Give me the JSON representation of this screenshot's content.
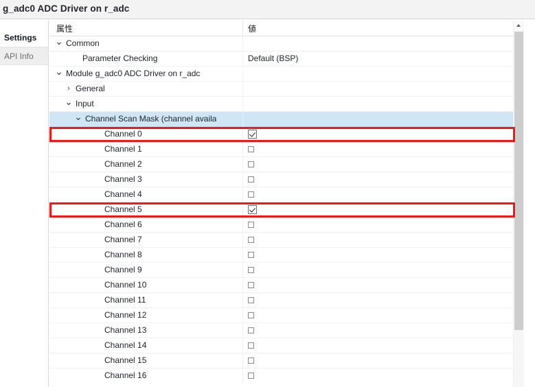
{
  "window": {
    "title": "g_adc0 ADC Driver on r_adc"
  },
  "tabs": [
    {
      "label": "Settings",
      "active": true
    },
    {
      "label": "API Info",
      "active": false
    }
  ],
  "table": {
    "columns": [
      {
        "key": "property",
        "label": "属性"
      },
      {
        "key": "value",
        "label": "値"
      }
    ]
  },
  "rows": [
    {
      "label": "Common",
      "indent": 0,
      "chevron": "v",
      "value": "",
      "control": "none"
    },
    {
      "label": "Parameter Checking",
      "indent": 1,
      "chevron": "",
      "value": "Default (BSP)",
      "control": "text"
    },
    {
      "label": "Module g_adc0 ADC Driver on r_adc",
      "indent": 0,
      "chevron": "v",
      "value": "",
      "control": "none"
    },
    {
      "label": "General",
      "indent": 1,
      "chevron": ">",
      "value": "",
      "control": "none"
    },
    {
      "label": "Input",
      "indent": 1,
      "chevron": "v",
      "value": "",
      "control": "none"
    },
    {
      "label": "Channel Scan Mask (channel availa",
      "indent": 2,
      "chevron": "v",
      "value": "",
      "control": "none",
      "selected": true,
      "truncated": true
    },
    {
      "label": "Channel 0",
      "indent": 3,
      "chevron": "",
      "value": "",
      "control": "checkbox",
      "checked": true,
      "highlighted": true
    },
    {
      "label": "Channel 1",
      "indent": 3,
      "chevron": "",
      "value": "",
      "control": "checkbox",
      "checked": false
    },
    {
      "label": "Channel 2",
      "indent": 3,
      "chevron": "",
      "value": "",
      "control": "checkbox",
      "checked": false
    },
    {
      "label": "Channel 3",
      "indent": 3,
      "chevron": "",
      "value": "",
      "control": "checkbox",
      "checked": false
    },
    {
      "label": "Channel 4",
      "indent": 3,
      "chevron": "",
      "value": "",
      "control": "checkbox",
      "checked": false
    },
    {
      "label": "Channel 5",
      "indent": 3,
      "chevron": "",
      "value": "",
      "control": "checkbox",
      "checked": true,
      "highlighted": true
    },
    {
      "label": "Channel 6",
      "indent": 3,
      "chevron": "",
      "value": "",
      "control": "checkbox",
      "checked": false
    },
    {
      "label": "Channel 7",
      "indent": 3,
      "chevron": "",
      "value": "",
      "control": "checkbox",
      "checked": false
    },
    {
      "label": "Channel 8",
      "indent": 3,
      "chevron": "",
      "value": "",
      "control": "checkbox",
      "checked": false
    },
    {
      "label": "Channel 9",
      "indent": 3,
      "chevron": "",
      "value": "",
      "control": "checkbox",
      "checked": false
    },
    {
      "label": "Channel 10",
      "indent": 3,
      "chevron": "",
      "value": "",
      "control": "checkbox",
      "checked": false
    },
    {
      "label": "Channel 11",
      "indent": 3,
      "chevron": "",
      "value": "",
      "control": "checkbox",
      "checked": false
    },
    {
      "label": "Channel 12",
      "indent": 3,
      "chevron": "",
      "value": "",
      "control": "checkbox",
      "checked": false
    },
    {
      "label": "Channel 13",
      "indent": 3,
      "chevron": "",
      "value": "",
      "control": "checkbox",
      "checked": false
    },
    {
      "label": "Channel 14",
      "indent": 3,
      "chevron": "",
      "value": "",
      "control": "checkbox",
      "checked": false
    },
    {
      "label": "Channel 15",
      "indent": 3,
      "chevron": "",
      "value": "",
      "control": "checkbox",
      "checked": false
    },
    {
      "label": "Channel 16",
      "indent": 3,
      "chevron": "",
      "value": "",
      "control": "checkbox",
      "checked": false,
      "partial": true
    }
  ],
  "scrollbar": {
    "up_arrow": "scroll-up-arrow"
  },
  "annotations": {
    "color": "#fb1414",
    "boxes": [
      {
        "target": "Channel 0"
      },
      {
        "target": "Channel 5"
      }
    ]
  }
}
